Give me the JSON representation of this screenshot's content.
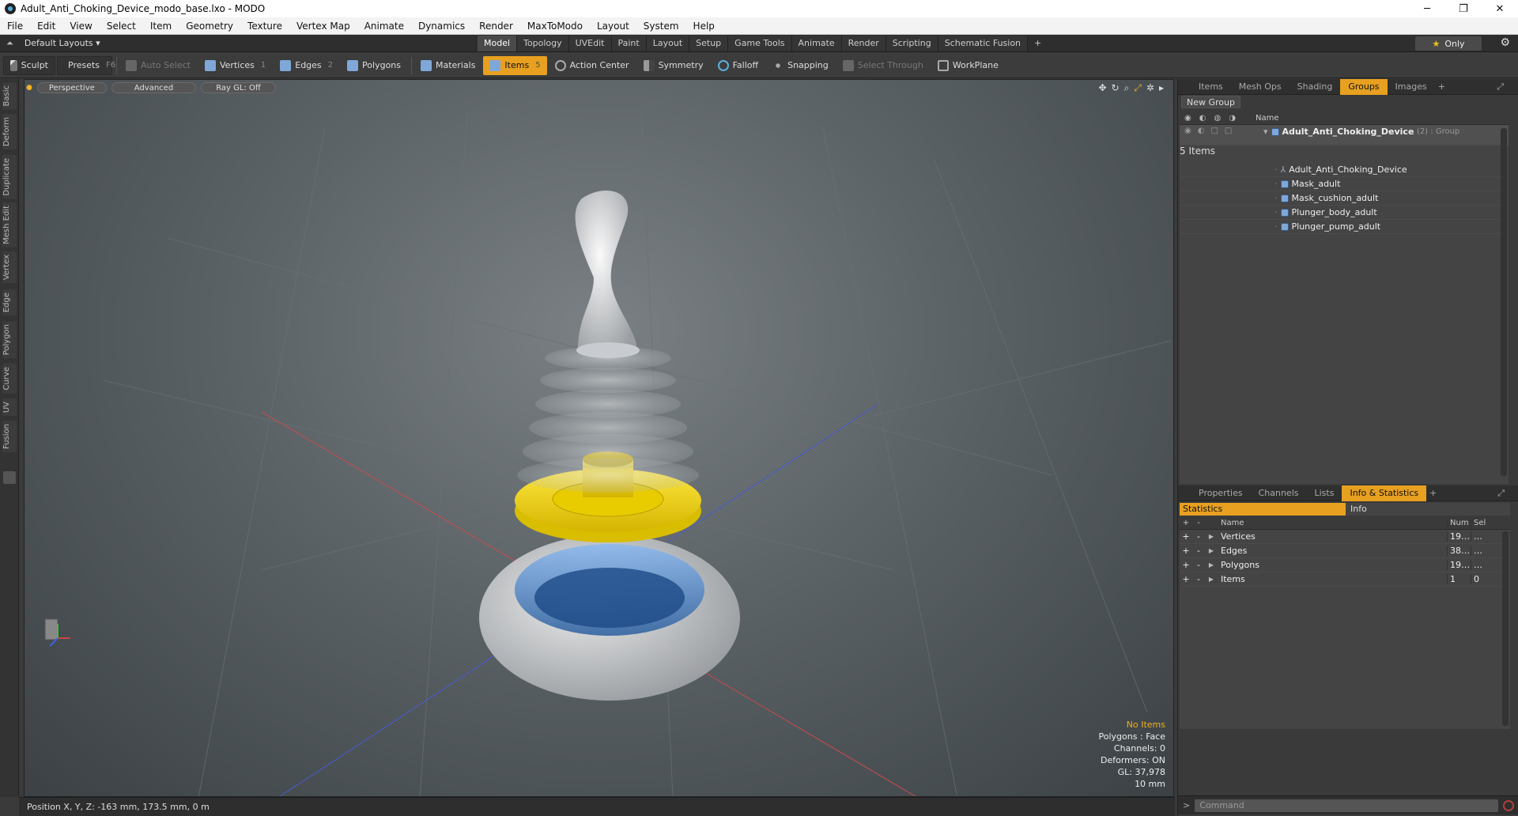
{
  "window": {
    "title": "Adult_Anti_Choking_Device_modo_base.lxo - MODO",
    "min": "─",
    "max": "❐",
    "close": "✕"
  },
  "menu": [
    "File",
    "Edit",
    "View",
    "Select",
    "Item",
    "Geometry",
    "Texture",
    "Vertex Map",
    "Animate",
    "Dynamics",
    "Render",
    "MaxToModo",
    "Layout",
    "System",
    "Help"
  ],
  "layouts": {
    "label": "Default Layouts ▾"
  },
  "tabs": [
    "Model",
    "Topology",
    "UVEdit",
    "Paint",
    "Layout",
    "Setup",
    "Game Tools",
    "Animate",
    "Render",
    "Scripting",
    "Schematic Fusion"
  ],
  "only_label": "Only",
  "toolbar": {
    "sculpt": "Sculpt",
    "presets": "Presets",
    "presets_key": "F6",
    "auto_select": "Auto Select",
    "vertices": "Vertices",
    "vertices_key": "1",
    "edges": "Edges",
    "edges_key": "2",
    "polygons": "Polygons",
    "materials": "Materials",
    "items": "Items",
    "items_key": "5",
    "action_center": "Action Center",
    "symmetry": "Symmetry",
    "falloff": "Falloff",
    "snapping": "Snapping",
    "select_through": "Select Through",
    "workplane": "WorkPlane"
  },
  "left_tabs": [
    "Basic",
    "Deform",
    "Duplicate",
    "Mesh Edit",
    "Vertex",
    "Edge",
    "Polygon",
    "Curve",
    "UV",
    "Fusion"
  ],
  "viewport": {
    "perspective": "Perspective",
    "advanced": "Advanced",
    "raygl": "Ray GL: Off",
    "info": {
      "no_items": "No Items",
      "polygons": "Polygons : Face",
      "channels": "Channels: 0",
      "deformers": "Deformers: ON",
      "gl": "GL: 37,978",
      "scale": "10 mm"
    }
  },
  "status": {
    "position": "Position X, Y, Z:  -163 mm, 173.5 mm, 0 m"
  },
  "panel_tabs": [
    "Items",
    "Mesh Ops",
    "Shading",
    "Groups",
    "Images"
  ],
  "panel_active": "Groups",
  "groups": {
    "new_group": "New Group",
    "name_col": "Name",
    "group_name": "Adult_Anti_Choking_Device",
    "group_suffix": "(2) : Group",
    "group_items": "5 Items",
    "children": [
      "Adult_Anti_Choking_Device",
      "Mask_adult",
      "Mask_cushion_adult",
      "Plunger_body_adult",
      "Plunger_pump_adult"
    ]
  },
  "panel2_tabs": [
    "Properties",
    "Channels",
    "Lists",
    "Info & Statistics"
  ],
  "stats": {
    "tab_stats": "Statistics",
    "tab_info": "Info",
    "col_name": "Name",
    "col_num": "Num",
    "col_sel": "Sel",
    "rows": [
      {
        "name": "Vertices",
        "num": "19…",
        "sel": "…"
      },
      {
        "name": "Edges",
        "num": "38…",
        "sel": "…"
      },
      {
        "name": "Polygons",
        "num": "19…",
        "sel": "…"
      },
      {
        "name": "Items",
        "num": "1",
        "sel": "0"
      }
    ]
  },
  "command": {
    "placeholder": "Command"
  }
}
